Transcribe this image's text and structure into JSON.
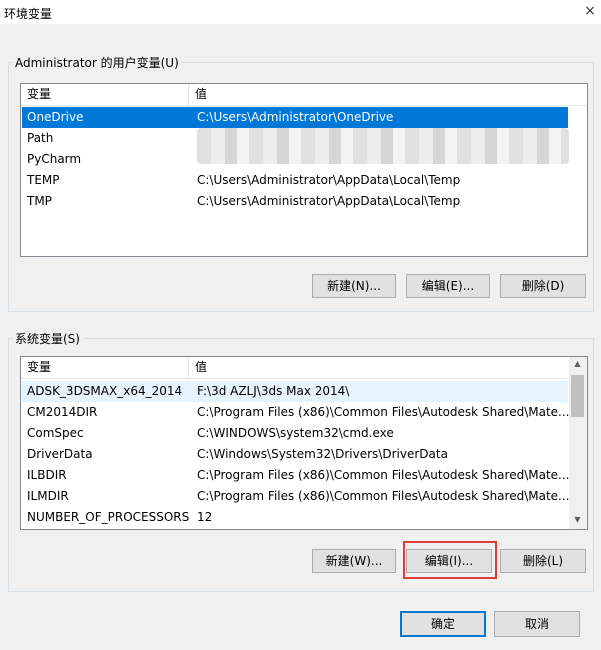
{
  "window": {
    "title": "环境变量",
    "close_glyph": "×"
  },
  "user_vars": {
    "group_label": "Administrator 的用户变量(U)",
    "columns": [
      "变量",
      "值"
    ],
    "rows": [
      {
        "name": "OneDrive",
        "value": "C:\\Users\\Administrator\\OneDrive"
      },
      {
        "name": "Path",
        "value": ""
      },
      {
        "name": "PyCharm",
        "value": ""
      },
      {
        "name": "TEMP",
        "value": "C:\\Users\\Administrator\\AppData\\Local\\Temp"
      },
      {
        "name": "TMP",
        "value": "C:\\Users\\Administrator\\AppData\\Local\\Temp"
      }
    ],
    "buttons": {
      "new": "新建(N)...",
      "edit": "编辑(E)...",
      "delete": "删除(D)"
    }
  },
  "system_vars": {
    "group_label": "系统变量(S)",
    "columns": [
      "变量",
      "值"
    ],
    "rows": [
      {
        "name": "ADSK_3DSMAX_x64_2014",
        "value": "F:\\3d    AZLJ\\3ds Max 2014\\"
      },
      {
        "name": "CM2014DIR",
        "value": "C:\\Program Files (x86)\\Common Files\\Autodesk Shared\\Mate..."
      },
      {
        "name": "ComSpec",
        "value": "C:\\WINDOWS\\system32\\cmd.exe"
      },
      {
        "name": "DriverData",
        "value": "C:\\Windows\\System32\\Drivers\\DriverData"
      },
      {
        "name": "ILBDIR",
        "value": "C:\\Program Files (x86)\\Common Files\\Autodesk Shared\\Mate..."
      },
      {
        "name": "ILMDIR",
        "value": "C:\\Program Files (x86)\\Common Files\\Autodesk Shared\\Mate..."
      },
      {
        "name": "NUMBER_OF_PROCESSORS",
        "value": "12"
      }
    ],
    "buttons": {
      "new": "新建(W)...",
      "edit": "编辑(I)...",
      "delete": "删除(L)"
    }
  },
  "footer": {
    "ok": "确定",
    "cancel": "取消"
  },
  "colors": {
    "selection": "#0078d7",
    "highlight_box": "#e03c3c",
    "primary_border": "#0078d7"
  }
}
